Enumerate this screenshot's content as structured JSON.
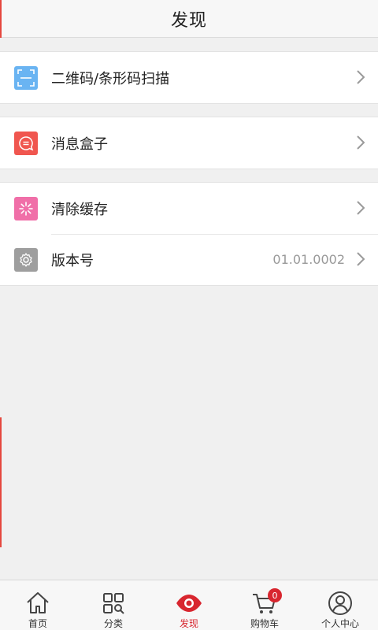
{
  "header": {
    "title": "发现"
  },
  "menu": {
    "scan": {
      "label": "二维码/条形码扫描",
      "icon": "scan-icon",
      "color": "#6ab4f2"
    },
    "messages": {
      "label": "消息盒子",
      "icon": "message-icon",
      "color": "#f0564f"
    },
    "clear_cache": {
      "label": "清除缓存",
      "icon": "clear-cache-icon",
      "color": "#f06fa8"
    },
    "version": {
      "label": "版本号",
      "value": "01.01.0002",
      "icon": "settings-icon",
      "color": "#9e9e9e"
    }
  },
  "tabbar": {
    "home": {
      "label": "首页",
      "icon": "home-icon"
    },
    "category": {
      "label": "分类",
      "icon": "category-icon"
    },
    "discover": {
      "label": "发现",
      "icon": "eye-icon",
      "active": true
    },
    "cart": {
      "label": "购物车",
      "icon": "cart-icon",
      "badge": "0"
    },
    "profile": {
      "label": "个人中心",
      "icon": "user-icon"
    }
  },
  "colors": {
    "accent": "#d8262f",
    "background": "#f0f0f0"
  }
}
